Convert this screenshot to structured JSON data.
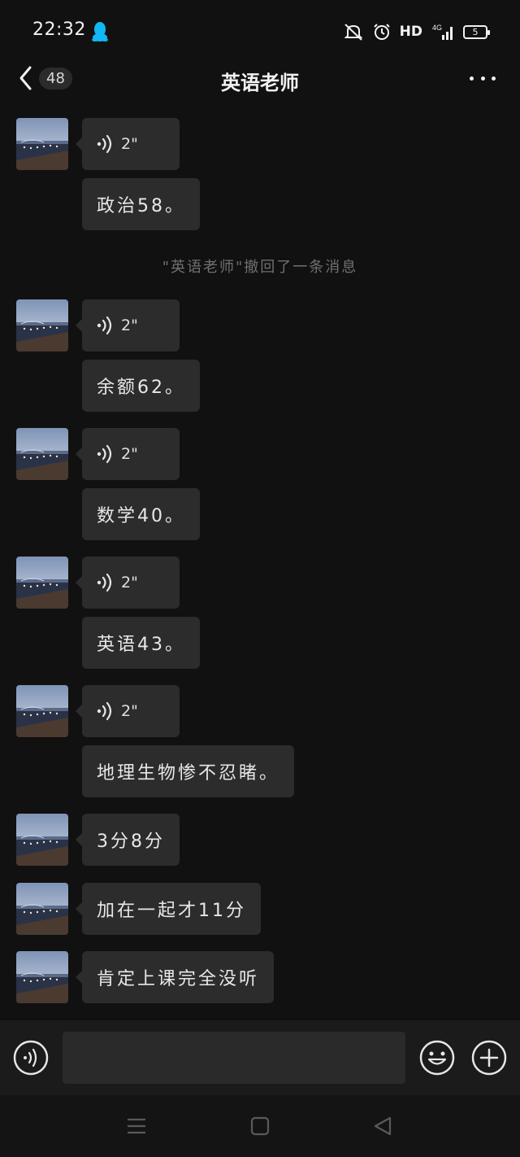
{
  "status_bar": {
    "time": "22:32",
    "network_label": "HD",
    "network_type": "4G",
    "battery_level": "5",
    "icons": [
      "qq-icon",
      "mute-icon",
      "alarm-icon",
      "signal-icon",
      "battery-icon"
    ]
  },
  "header": {
    "back_count": "48",
    "title": "英语老师"
  },
  "messages": [
    {
      "type": "voice",
      "duration": "2\""
    },
    {
      "type": "text",
      "text": "政治58。"
    },
    {
      "type": "system",
      "text": "\"英语老师\"撤回了一条消息"
    },
    {
      "type": "voice",
      "duration": "2\""
    },
    {
      "type": "text",
      "text": "余额62。"
    },
    {
      "type": "voice",
      "duration": "2\""
    },
    {
      "type": "text",
      "text": "数学40。"
    },
    {
      "type": "voice",
      "duration": "2\""
    },
    {
      "type": "text",
      "text": "英语43。"
    },
    {
      "type": "voice",
      "duration": "2\""
    },
    {
      "type": "text",
      "text": "地理生物惨不忍睹。"
    },
    {
      "type": "text",
      "text": "3分8分"
    },
    {
      "type": "text",
      "text": "加在一起才11分"
    },
    {
      "type": "text",
      "text": "肯定上课完全没听"
    }
  ],
  "input_bar": {
    "placeholder": "",
    "icons": [
      "voice-input-icon",
      "emoji-icon",
      "plus-icon"
    ]
  },
  "nav_bar": {
    "icons": [
      "menu-icon",
      "home-icon",
      "back-triangle-icon"
    ]
  },
  "colors": {
    "background": "#111111",
    "bubble": "#2c2c2c",
    "text": "#e8e8e8",
    "system_text": "#707070",
    "accent_qq": "#12b7f5"
  }
}
